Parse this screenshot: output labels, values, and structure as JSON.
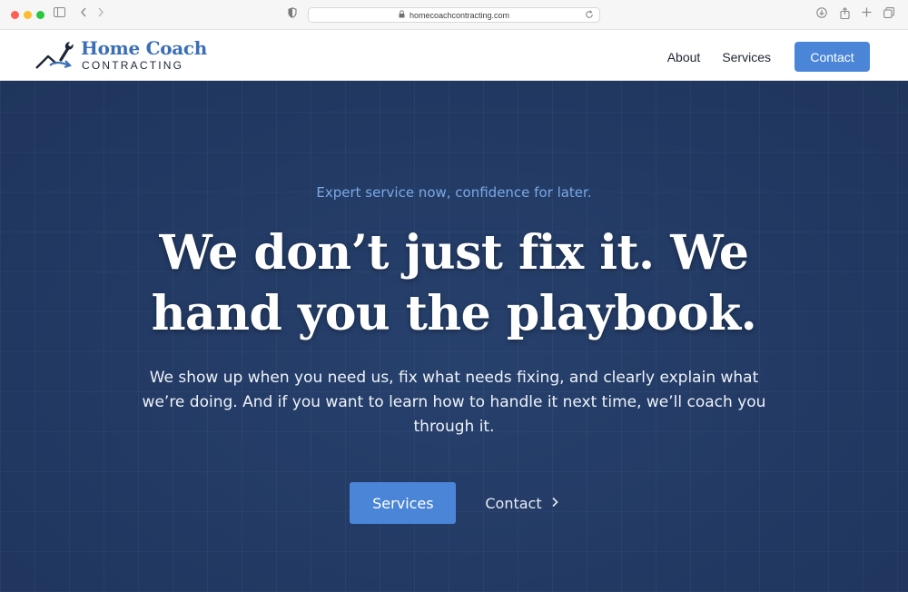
{
  "browser": {
    "url": "homecoachcontracting.com",
    "traffic_lights": [
      "#ff5f57",
      "#febc2e",
      "#28c840"
    ]
  },
  "header": {
    "logo": {
      "line1": "Home Coach",
      "line2": "CONTRACTING",
      "brand_color": "#3a6fb8"
    },
    "nav": {
      "about": "About",
      "services": "Services",
      "contact": "Contact"
    },
    "accent": "#4a85d8"
  },
  "hero": {
    "eyebrow": "Expert service now, confidence for later.",
    "headline": "We don’t just fix it. We hand you the playbook.",
    "subcopy": "We show up when you need us, fix what needs fixing, and clearly explain what we’re doing. And if you want to learn how to handle it next time, we’ll coach you through it.",
    "primary_cta": "Services",
    "secondary_cta": "Contact",
    "background": "#233a63"
  }
}
